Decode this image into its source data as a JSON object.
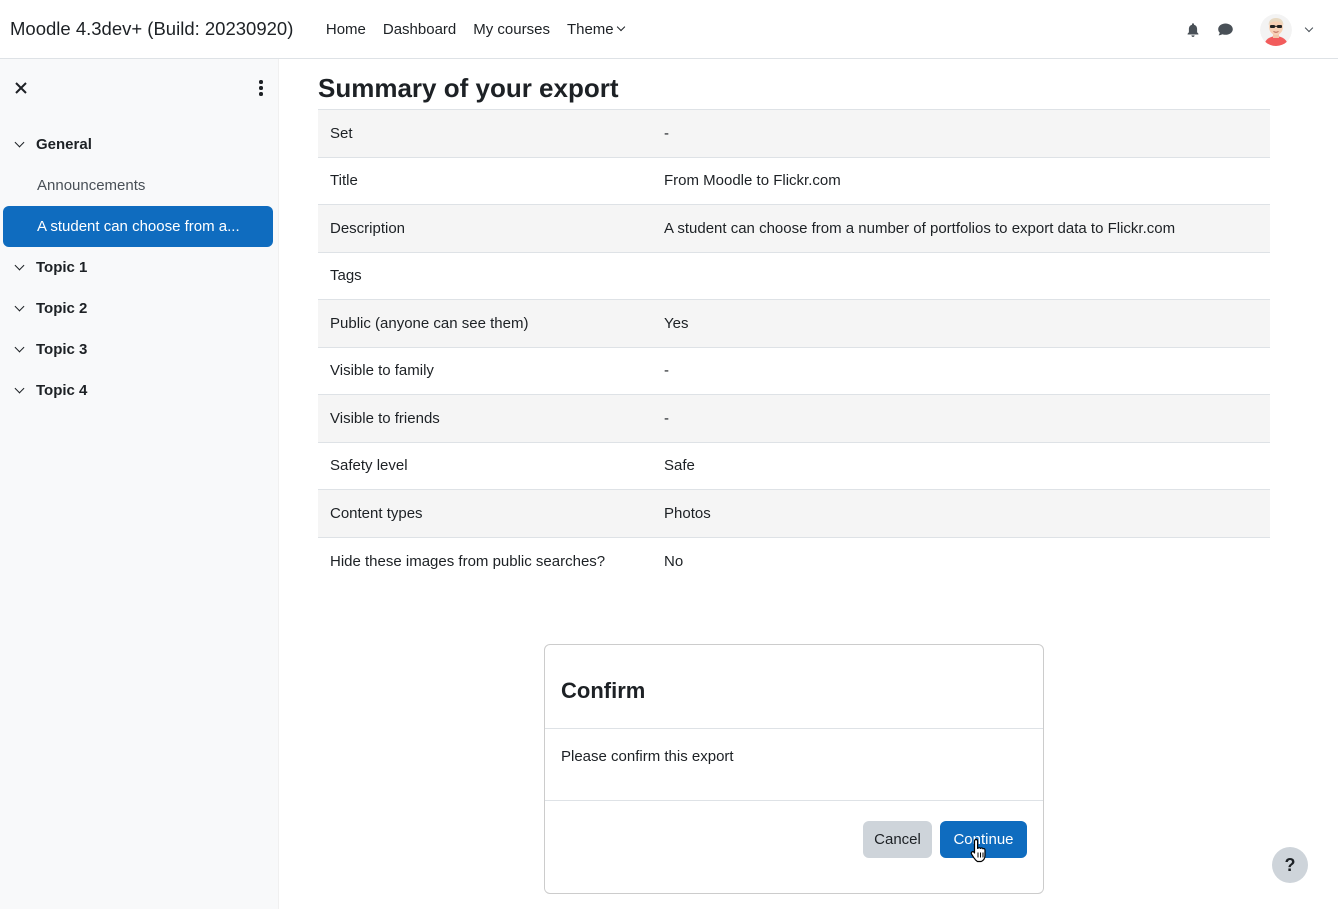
{
  "navbar": {
    "brand": "Moodle 4.3dev+ (Build: 20230920)",
    "links": [
      {
        "label": "Home"
      },
      {
        "label": "Dashboard"
      },
      {
        "label": "My courses"
      },
      {
        "label": "Theme"
      }
    ]
  },
  "drawer": {
    "sections": [
      {
        "label": "General",
        "items": [
          {
            "label": "Announcements",
            "active": false
          },
          {
            "label": "A student can choose from a...",
            "active": true
          }
        ]
      },
      {
        "label": "Topic 1"
      },
      {
        "label": "Topic 2"
      },
      {
        "label": "Topic 3"
      },
      {
        "label": "Topic 4"
      }
    ]
  },
  "main": {
    "title": "Summary of your export",
    "rows": [
      {
        "key": "Set",
        "value": "-"
      },
      {
        "key": "Title",
        "value": "From Moodle to Flickr.com"
      },
      {
        "key": "Description",
        "value": "A student can choose from a number of portfolios to export data to Flickr.com"
      },
      {
        "key": "Tags",
        "value": ""
      },
      {
        "key": "Public (anyone can see them)",
        "value": "Yes"
      },
      {
        "key": "Visible to family",
        "value": "-"
      },
      {
        "key": "Visible to friends",
        "value": "-"
      },
      {
        "key": "Safety level",
        "value": "Safe"
      },
      {
        "key": "Content types",
        "value": "Photos"
      },
      {
        "key": "Hide these images from public searches?",
        "value": "No"
      }
    ]
  },
  "confirm": {
    "title": "Confirm",
    "message": "Please confirm this export",
    "cancel_label": "Cancel",
    "continue_label": "Continue"
  },
  "help": {
    "label": "?"
  },
  "colors": {
    "primary": "#0f6cbf",
    "secondary": "#ced4da",
    "drawer_bg": "#f8f9fa",
    "text": "#1d2125"
  }
}
